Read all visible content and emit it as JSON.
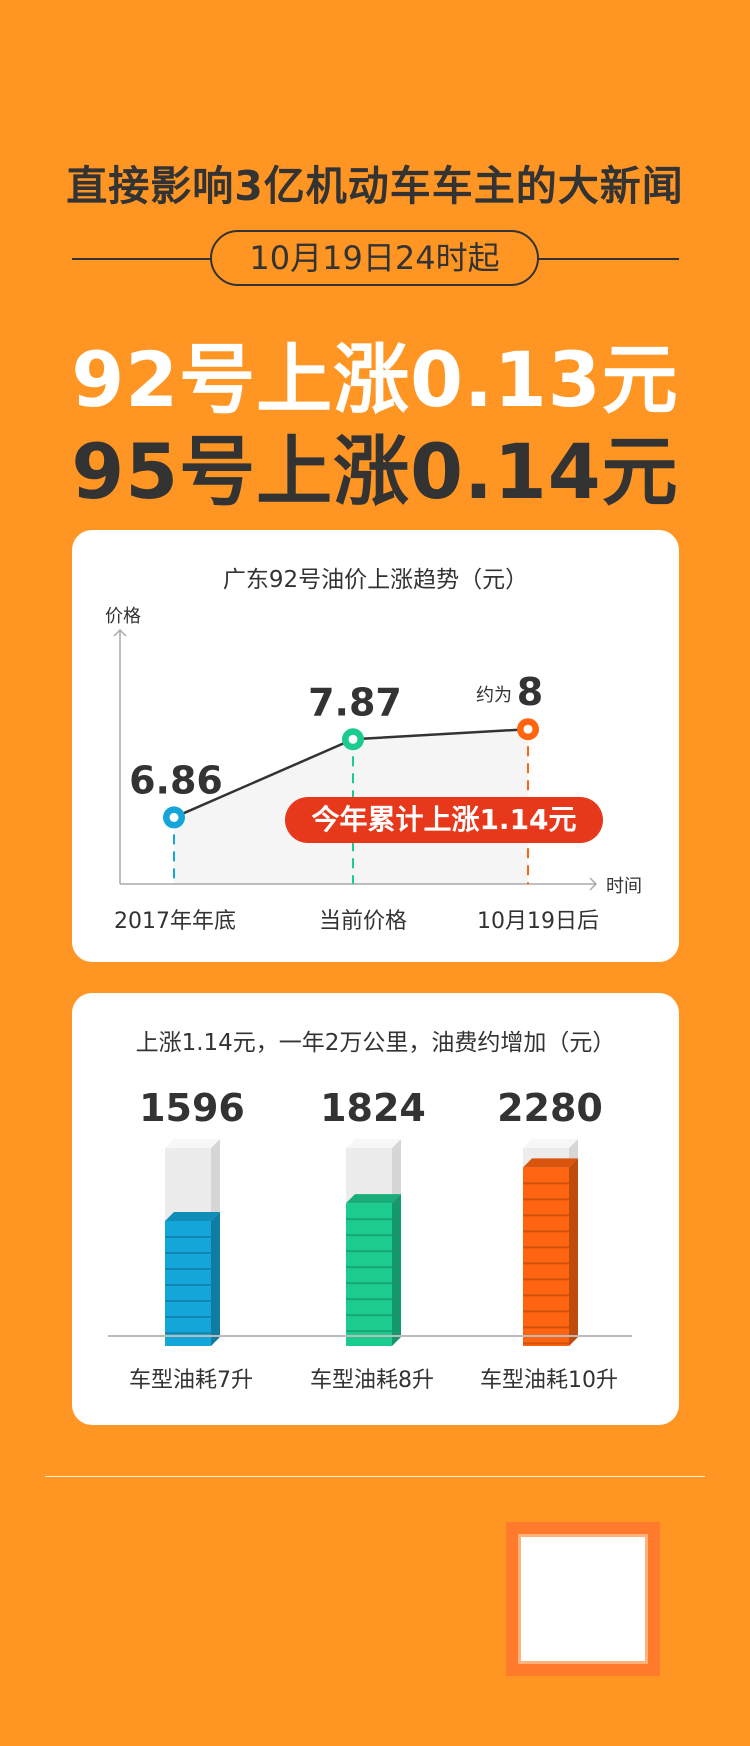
{
  "headline": "直接影响3亿机动车车主的大新闻",
  "date_badge": "10月19日24时起",
  "line1": "92号上涨0.13元",
  "line2": "95号上涨0.14元",
  "colors": {
    "background": "#FF9624",
    "dark": "#333333",
    "blue": "#14A6D8",
    "green": "#1CCB8E",
    "red_orange": "#FF6410",
    "highlight_red": "#E8381C"
  },
  "chart_data": [
    {
      "type": "line",
      "title": "广东92号油价上涨趋势（元）",
      "ylabel": "价格",
      "xlabel": "时间",
      "categories": [
        "2017年年底",
        "当前价格",
        "10月19日后"
      ],
      "values": [
        6.86,
        7.87,
        8
      ],
      "point_labels": [
        "6.86",
        "7.87",
        "8"
      ],
      "point_prefix": [
        "",
        "",
        "约为"
      ],
      "point_colors": [
        "#14A6D8",
        "#1CCB8E",
        "#FF6410"
      ],
      "ylim": [
        6,
        8.5
      ],
      "annotation": "今年累计上涨1.14元",
      "grid": false
    },
    {
      "type": "bar",
      "title": "上涨1.14元，一年2万公里，油费约增加（元）",
      "categories": [
        "车型油耗7升",
        "车型油耗8升",
        "车型油耗10升"
      ],
      "values": [
        1596,
        1824,
        2280
      ],
      "value_labels": [
        "1596",
        "1824",
        "2280"
      ],
      "bar_colors": [
        "#14A6D8",
        "#1CCB8E",
        "#FF6410"
      ],
      "ylim": [
        0,
        2400
      ],
      "grid": false
    }
  ]
}
